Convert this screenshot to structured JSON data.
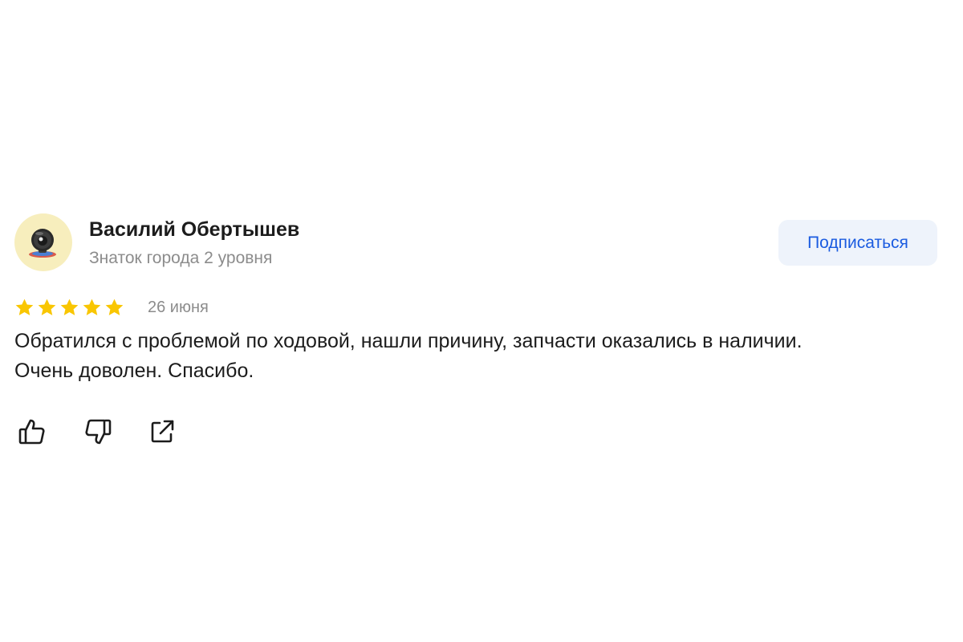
{
  "review": {
    "author": {
      "name": "Василий Обертышев",
      "level": "Знаток города 2 уровня",
      "avatar_icon": "webcam-avatar-icon"
    },
    "subscribe_label": "Подписаться",
    "rating": 5,
    "rating_max": 5,
    "date": "26 июня",
    "text_lines": [
      "Обратился с проблемой по ходовой, нашли причину, запчасти оказались в наличии.",
      "Очень доволен. Спасибо."
    ],
    "actions": [
      {
        "icon": "thumbs-up-icon"
      },
      {
        "icon": "thumbs-down-icon"
      },
      {
        "icon": "share-icon"
      }
    ]
  },
  "colors": {
    "star": "#f9c602",
    "accent": "#1a5be0",
    "button_bg": "#eef3fb",
    "muted_text": "#8c8c8c",
    "avatar_bg": "#f7eebd"
  }
}
